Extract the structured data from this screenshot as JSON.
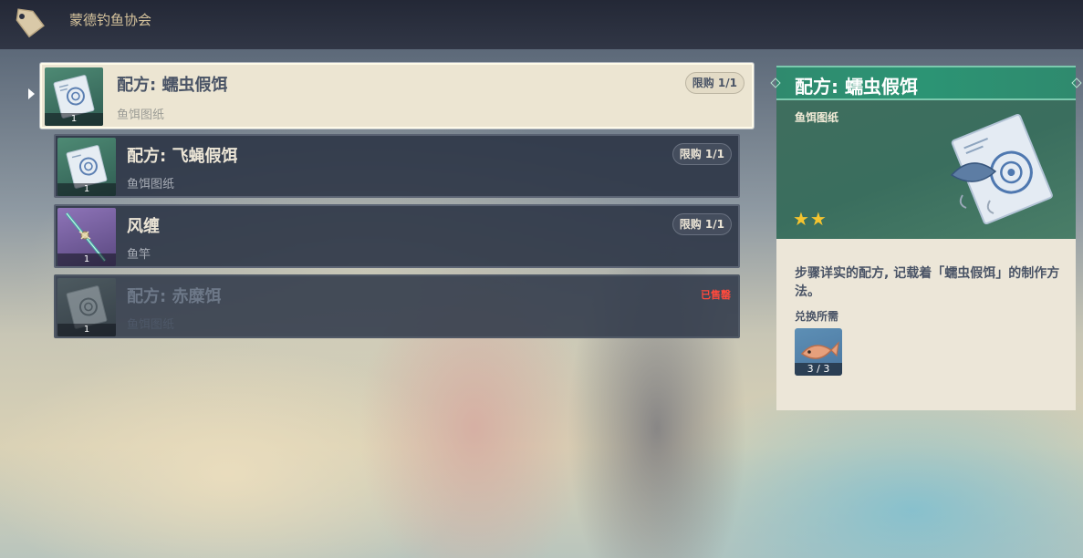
{
  "header": {
    "shop_name": "蒙德钓鱼协会",
    "icon": "price-tag-icon"
  },
  "items": [
    {
      "name": "配方: 蠕虫假饵",
      "type": "鱼饵图纸",
      "limit": "限购 1/1",
      "count": "1",
      "icon": "bait-blueprint-icon",
      "selected": true
    },
    {
      "name": "配方: 飞蝇假饵",
      "type": "鱼饵图纸",
      "limit": "限购 1/1",
      "count": "1",
      "icon": "bait-blueprint-icon",
      "selected": false
    },
    {
      "name": "风缠",
      "type": "鱼竿",
      "limit": "限购 1/1",
      "count": "1",
      "icon": "fishing-rod-icon",
      "selected": false
    },
    {
      "name": "配方: 赤糜饵",
      "type": "鱼饵图纸",
      "status": "已售罄",
      "count": "1",
      "icon": "bait-blueprint-icon",
      "selected": false
    }
  ],
  "detail": {
    "title": "配方: 蠕虫假饵",
    "type": "鱼饵图纸",
    "rarity": 2,
    "stars": "★★",
    "description": "步骤详实的配方, 记载着「蠕虫假饵」的制作方法。",
    "requirement_title": "兑换所需",
    "requirement": {
      "icon": "fish-icon",
      "count": "3 / 3"
    }
  },
  "colors": {
    "accent_green": "#2c9474",
    "sold_out_red": "#ff4a3d",
    "star_gold": "#f5c42f"
  }
}
